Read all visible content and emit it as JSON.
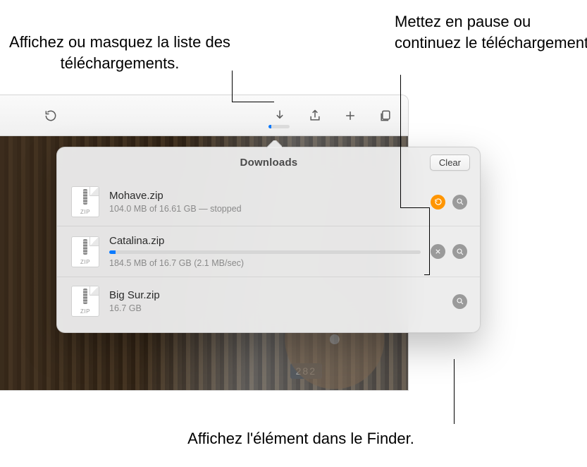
{
  "callouts": {
    "show_hide": "Affichez ou masquez la liste des téléchargements.",
    "pause_resume": "Mettez en pause ou continuez le téléchargement.",
    "reveal_finder": "Affichez l'élément dans le Finder."
  },
  "toolbar": {
    "download_progress_percent": 12
  },
  "popover": {
    "title": "Downloads",
    "clear_label": "Clear"
  },
  "downloads": [
    {
      "name": "Mohave.zip",
      "status": "104.0 MB of 16.61 GB — stopped",
      "ext": "ZIP",
      "state": "stopped"
    },
    {
      "name": "Catalina.zip",
      "status": "184.5 MB of 16.7 GB (2.1 MB/sec)",
      "ext": "ZIP",
      "state": "downloading",
      "progress_percent": 2
    },
    {
      "name": "Big Sur.zip",
      "status": "16.7 GB",
      "ext": "ZIP",
      "state": "done"
    }
  ],
  "bg": {
    "street_number": "282"
  }
}
